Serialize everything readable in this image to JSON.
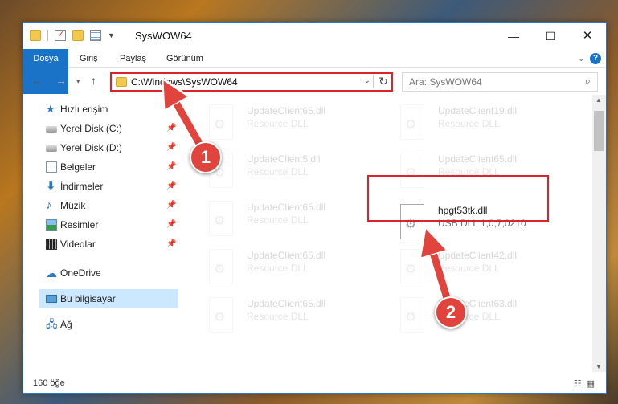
{
  "window": {
    "title": "SysWOW64",
    "controls": {
      "minimize": "—",
      "maximize": "☐",
      "close": "✕"
    }
  },
  "ribbon": {
    "tabs": [
      "Dosya",
      "Giriş",
      "Paylaş",
      "Görünüm"
    ],
    "help": "?"
  },
  "nav": {
    "address": "C:\\Windows\\SysWOW64",
    "search_placeholder": "Ara: SysWOW64"
  },
  "sidebar": {
    "items": [
      {
        "label": "Hızlı erişim",
        "icon": "star-icon",
        "pinned": false
      },
      {
        "label": "Yerel Disk (C:)",
        "icon": "disk-icon",
        "pinned": true
      },
      {
        "label": "Yerel Disk (D:)",
        "icon": "disk-icon",
        "pinned": true
      },
      {
        "label": "Belgeler",
        "icon": "documents-icon",
        "pinned": true
      },
      {
        "label": "İndirmeler",
        "icon": "downloads-icon",
        "pinned": true
      },
      {
        "label": "Müzik",
        "icon": "music-icon",
        "pinned": true
      },
      {
        "label": "Resimler",
        "icon": "pictures-icon",
        "pinned": true
      },
      {
        "label": "Videolar",
        "icon": "videos-icon",
        "pinned": true
      },
      {
        "label": "OneDrive",
        "icon": "cloud-icon",
        "pinned": false
      },
      {
        "label": "Bu bilgisayar",
        "icon": "computer-icon",
        "pinned": false,
        "selected": true
      },
      {
        "label": "Ağ",
        "icon": "network-icon",
        "pinned": false
      }
    ]
  },
  "files": [
    {
      "name": "UpdateClient65.dll",
      "type": "Resource DLL",
      "faded": true
    },
    {
      "name": "UpdateClient19.dll",
      "type": "Resource DLL",
      "faded": true
    },
    {
      "name": "UpdateClient5.dll",
      "type": "Resource DLL",
      "faded": true
    },
    {
      "name": "UpdateClient65.dll",
      "type": "Resource DLL",
      "faded": true
    },
    {
      "name": "UpdateClient65.dll",
      "type": "Resource DLL",
      "faded": true
    },
    {
      "name": "hpgt53tk.dll",
      "type": "USB DLL 1,0,7,0210",
      "faded": false,
      "highlighted": true
    },
    {
      "name": "UpdateClient65.dll",
      "type": "Resource DLL",
      "faded": true
    },
    {
      "name": "UpdateClient42.dll",
      "type": "Resource DLL",
      "faded": true
    },
    {
      "name": "UpdateClient65.dll",
      "type": "Resource DLL",
      "faded": true
    },
    {
      "name": "UpdateClient63.dll",
      "type": "Resource DLL",
      "faded": true
    }
  ],
  "status": {
    "count": "160 öğe"
  },
  "annotations": {
    "step1": "1",
    "step2": "2",
    "color": "#e0443c"
  }
}
